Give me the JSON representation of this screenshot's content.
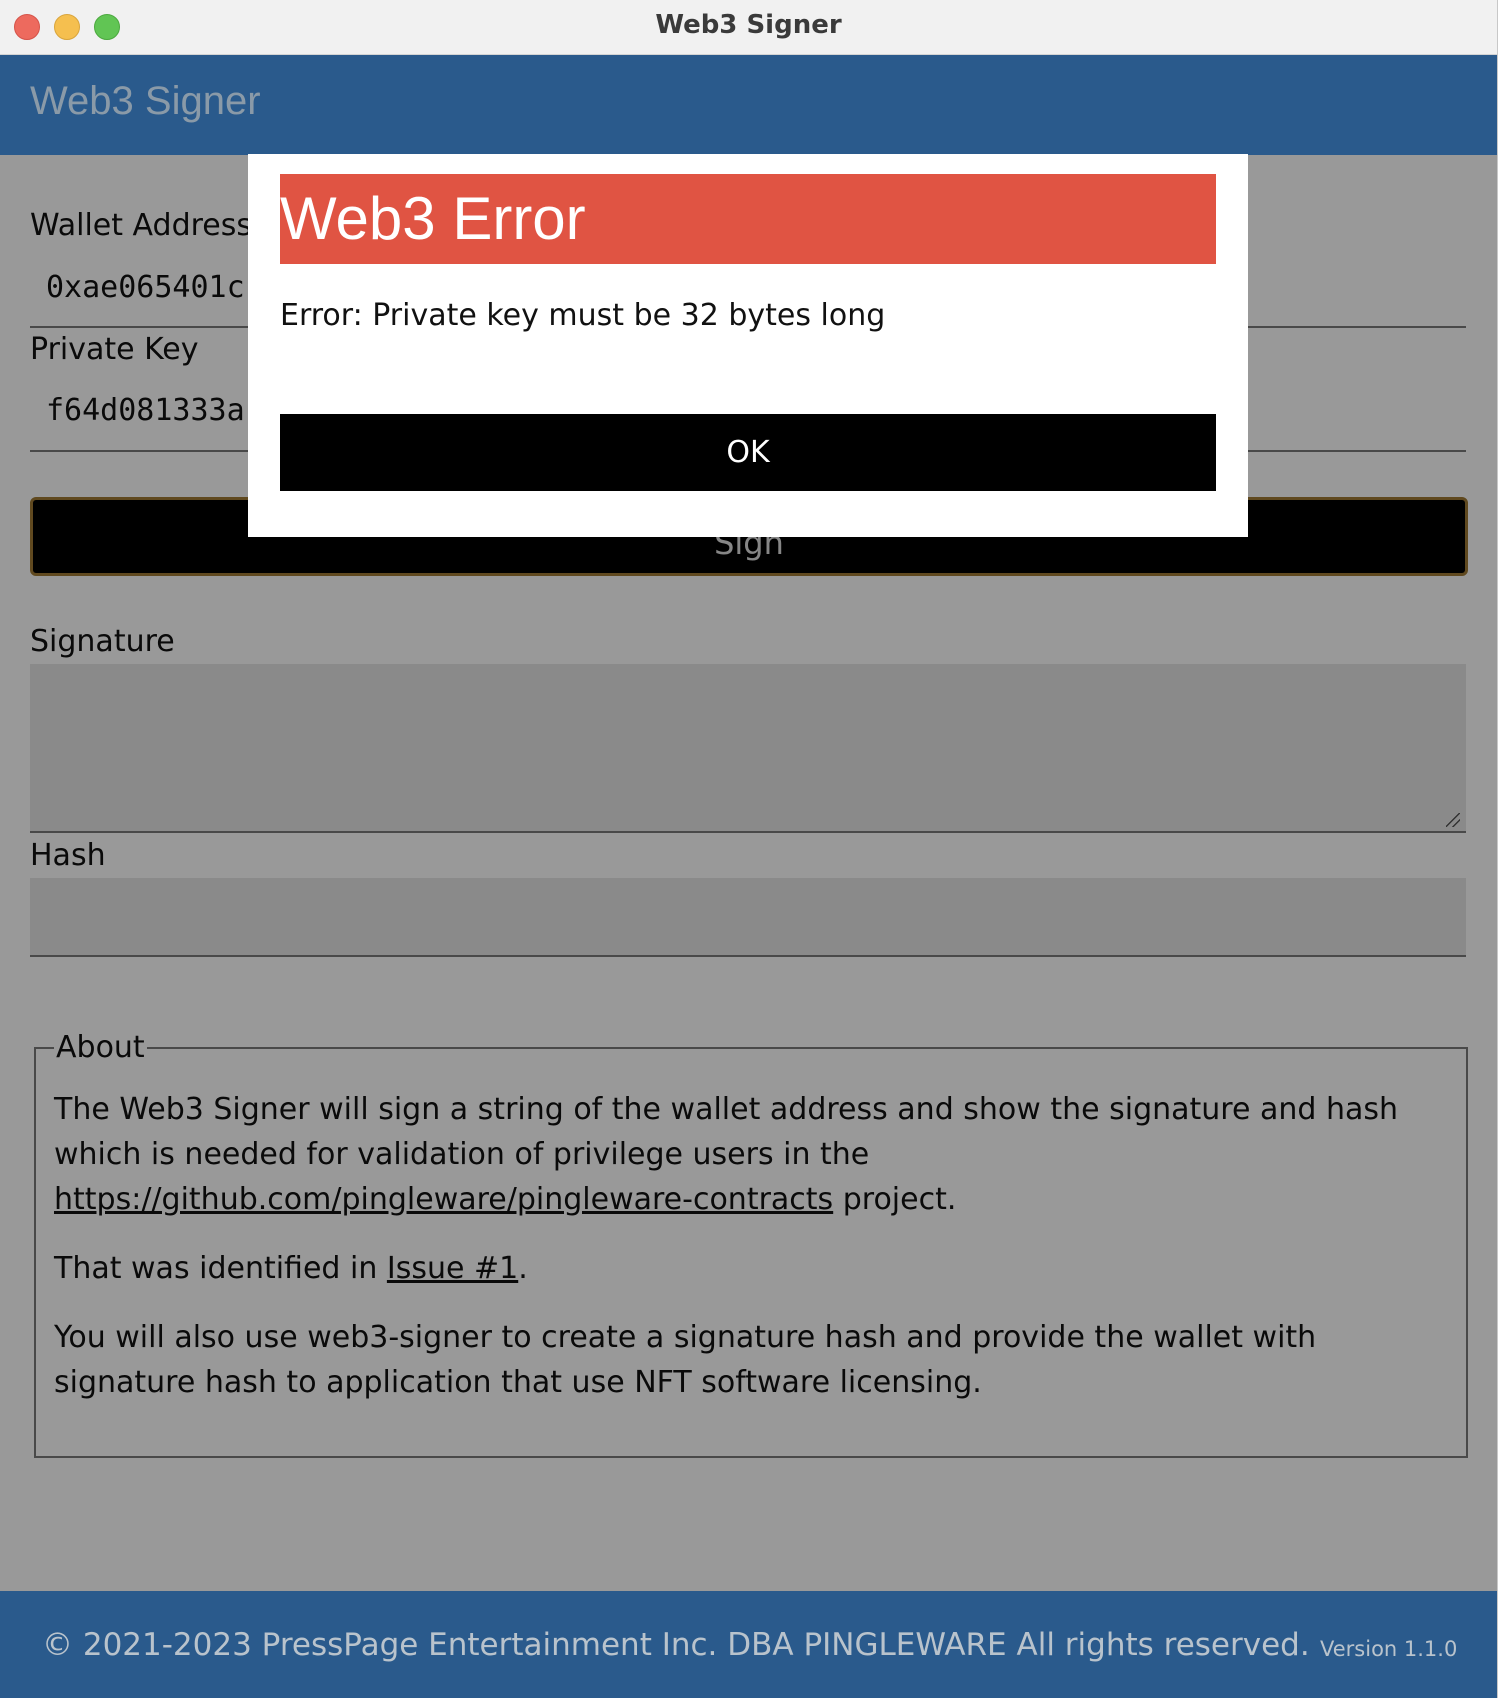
{
  "window": {
    "title": "Web3 Signer"
  },
  "app": {
    "title": "Web3 Signer"
  },
  "form": {
    "wallet_label": "Wallet Address",
    "wallet_value": "0xae065401c",
    "key_label": "Private Key",
    "key_value": "f64d081333a",
    "sign_label": "Sign",
    "signature_label": "Signature",
    "hash_label": "Hash"
  },
  "about": {
    "legend": "About",
    "p1": "The Web3 Signer will sign a string of the wallet address and show the signature and hash which is needed for validation of privilege users in the",
    "link": "https://github.com/pingleware/pingleware-contracts",
    "p1_end": "project.",
    "p2_start": "That was identified in",
    "issue_link": "Issue #1",
    "p2_end": ".",
    "p3": "You will also use web3-signer to create a signature hash and provide the wallet with signature hash to application that use NFT software licensing."
  },
  "footer": {
    "copyright": "© 2021-2023 PressPage Entertainment Inc. DBA PINGLEWARE  All rights reserved.",
    "version": "Version 1.1.0"
  },
  "modal": {
    "title": "Web3 Error",
    "message": "Error: Private key must be 32 bytes long",
    "ok_label": "OK"
  },
  "colors": {
    "header_bg": "#2a5a8c",
    "error_header": "#e05443",
    "sign_button_border": "#a07a34"
  }
}
